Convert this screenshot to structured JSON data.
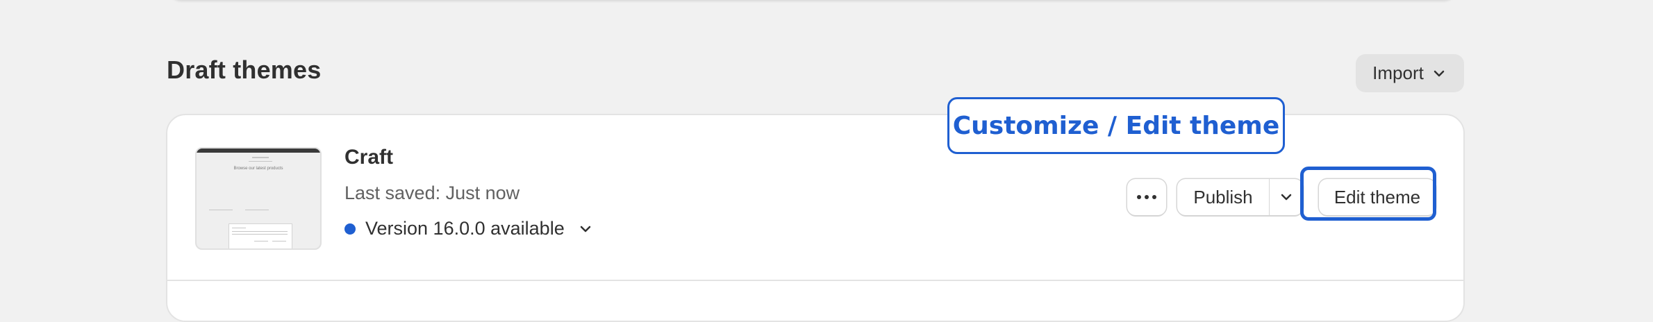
{
  "section": {
    "title": "Draft themes",
    "import_label": "Import"
  },
  "theme": {
    "name": "Craft",
    "saved": "Last saved: Just now",
    "version": "Version 16.0.0 available",
    "thumbnail_headline": "Browse our latest products",
    "actions": {
      "publish_label": "Publish",
      "edit_label": "Edit theme"
    }
  },
  "annotation": {
    "callout_text": "Customize / Edit theme",
    "accent_color": "#1f5fd1"
  },
  "icons": {
    "more": "more-horizontal-icon",
    "chevron": "chevron-down-icon",
    "status": "status-dot-icon"
  }
}
